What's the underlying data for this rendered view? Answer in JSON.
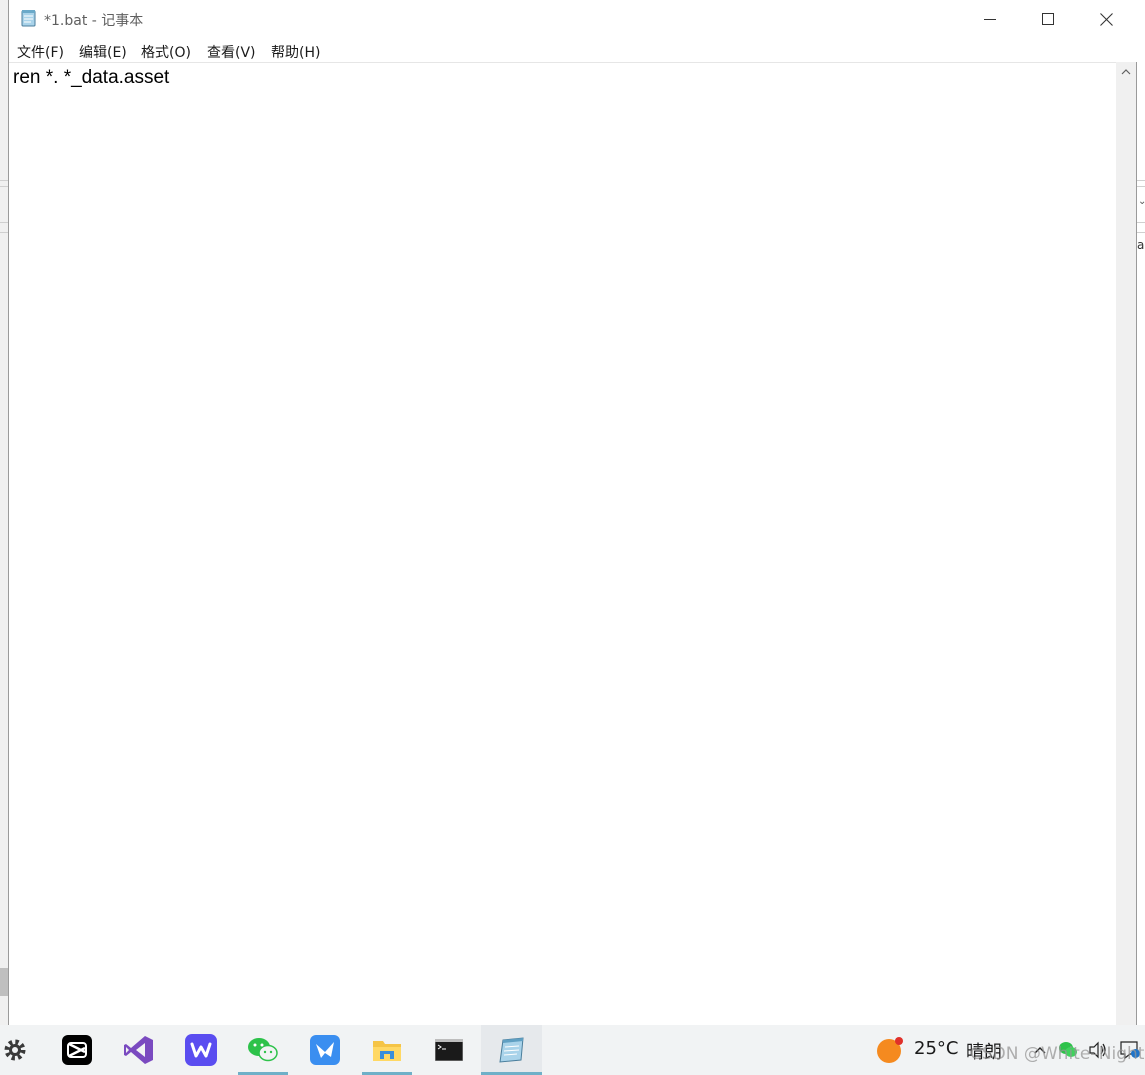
{
  "window": {
    "title": "*1.bat - 记事本",
    "icon": "notepad-icon",
    "controls": [
      "minimize-icon",
      "maximize-icon",
      "close-icon"
    ]
  },
  "menubar": {
    "file": "文件(F)",
    "edit": "编辑(E)",
    "format": "格式(O)",
    "view": "查看(V)",
    "help": "帮助(H)"
  },
  "editor": {
    "content": "ren *. *_data.asset"
  },
  "background_window": {
    "fragment": "a"
  },
  "taskbar": {
    "apps": [
      {
        "name": "settings-icon",
        "active": false
      },
      {
        "name": "capcut-icon",
        "active": false
      },
      {
        "name": "visual-studio-icon",
        "active": false
      },
      {
        "name": "wps-icon",
        "active": false
      },
      {
        "name": "wechat-icon",
        "active": true
      },
      {
        "name": "feishu-icon",
        "active": false
      },
      {
        "name": "file-explorer-icon",
        "active": true
      },
      {
        "name": "command-prompt-icon",
        "active": false
      },
      {
        "name": "notepad-icon",
        "active": true,
        "focused": true
      }
    ],
    "tray": {
      "temperature": "25°C",
      "weather": "晴朗",
      "weather_icon": "sun-icon",
      "icons": [
        "chevron-up-icon",
        "wechat-tray-icon",
        "volume-icon",
        "notification-icon"
      ]
    }
  },
  "watermark": "CSDN @White–Night",
  "colors": {
    "accent_underline": "#6fb0c8",
    "taskbar_bg": "#f1f3f4"
  }
}
